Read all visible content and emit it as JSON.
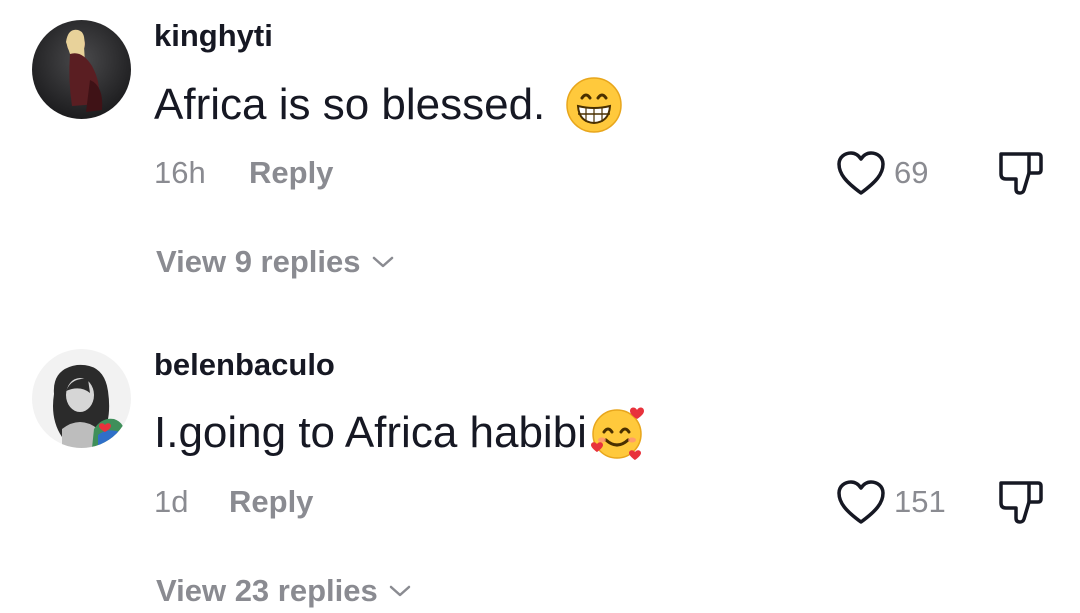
{
  "comments": [
    {
      "username": "kinghyti",
      "text": "Africa is so blessed.",
      "emoji": "grinning-face-with-smiling-eyes",
      "time": "16h",
      "reply_label": "Reply",
      "likes": "69",
      "view_replies": "View 9 replies"
    },
    {
      "username": "belenbaculo",
      "text": "I.going to Africa habibi",
      "emoji": "smiling-face-with-hearts",
      "time": "1d",
      "reply_label": "Reply",
      "likes": "151",
      "view_replies": "View 23 replies"
    }
  ],
  "colors": {
    "primary_text": "#161823",
    "secondary_text": "#8a8b91",
    "background": "#ffffff"
  }
}
